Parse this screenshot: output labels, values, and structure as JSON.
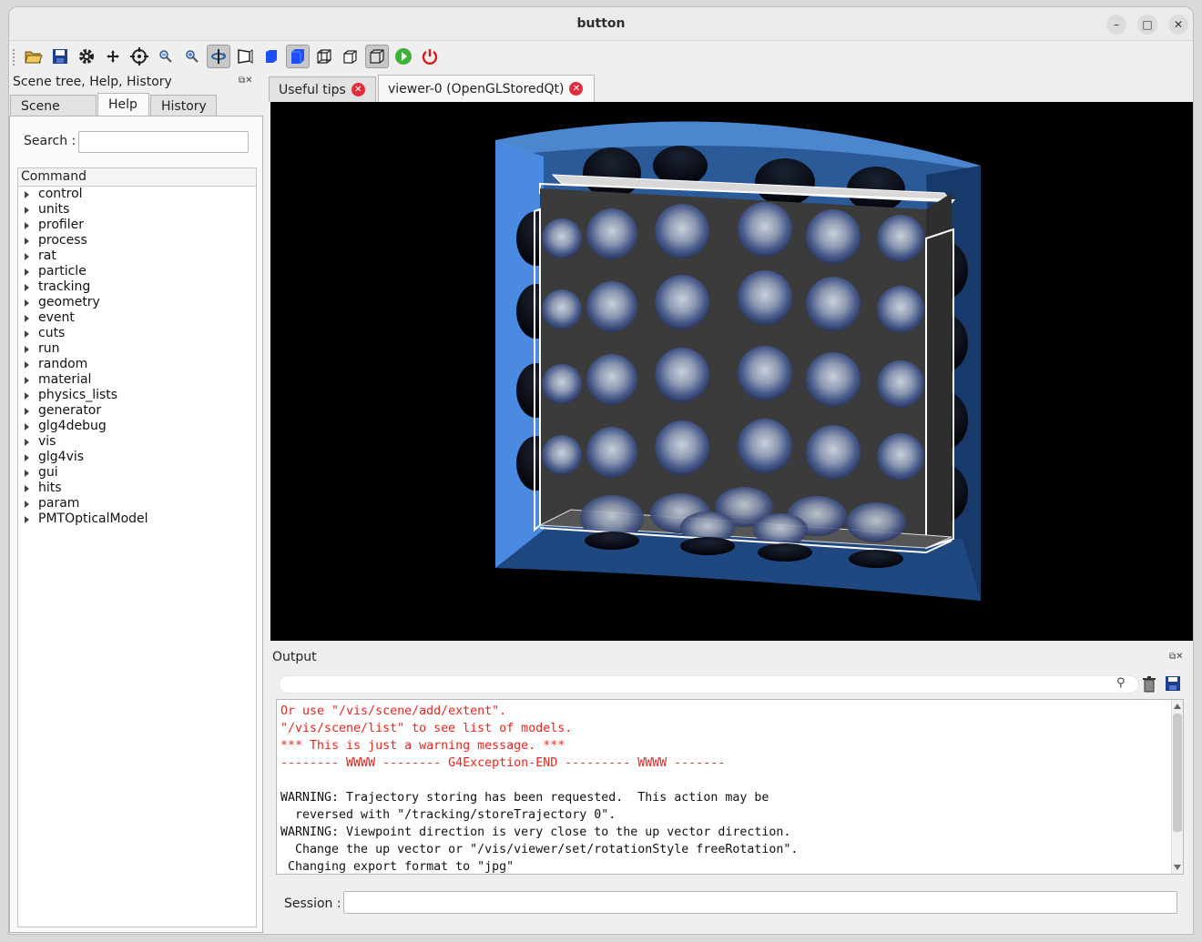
{
  "window": {
    "title": "button",
    "controls": {
      "minimize": "–",
      "maximize": "□",
      "close": "✕"
    }
  },
  "toolbar": {
    "items": [
      "open-icon",
      "save-icon",
      "gear-icon",
      "move-icon",
      "target-icon",
      "zoom-out-icon",
      "zoom-in-icon",
      "rotate-icon",
      "perspective-icon",
      "solid-blue-icon",
      "solid-shaded-icon",
      "wireframe-icon",
      "hidden-line-icon",
      "hidden-surface-icon",
      "run-icon",
      "power-icon"
    ]
  },
  "left_dock": {
    "title": "Scene tree, Help, History",
    "tabs": [
      {
        "label": "Scene tree"
      },
      {
        "label": "Help"
      },
      {
        "label": "History"
      }
    ],
    "active_tab": "Help",
    "search_label": "Search :",
    "search_value": "",
    "tree_header": "Command",
    "commands": [
      "control",
      "units",
      "profiler",
      "process",
      "rat",
      "particle",
      "tracking",
      "geometry",
      "event",
      "cuts",
      "run",
      "random",
      "material",
      "physics_lists",
      "generator",
      "glg4debug",
      "vis",
      "glg4vis",
      "gui",
      "hits",
      "param",
      "PMTOpticalModel"
    ]
  },
  "viewer_tabs": [
    {
      "label": "Useful tips"
    },
    {
      "label": "viewer-0 (OpenGLStoredQt)"
    }
  ],
  "output": {
    "label": "Output",
    "filter_value": "",
    "lines": [
      {
        "text": "Or use \"/vis/scene/add/extent\".",
        "color": "#e8261f"
      },
      {
        "text": "\"/vis/scene/list\" to see list of models.",
        "color": "#e8261f"
      },
      {
        "text": "*** This is just a warning message. ***",
        "color": "#e8261f"
      },
      {
        "text": "-------- WWWW -------- G4Exception-END --------- WWWW -------",
        "color": "#e8261f"
      },
      {
        "text": "",
        "color": "#111111"
      },
      {
        "text": "WARNING: Trajectory storing has been requested.  This action may be",
        "color": "#111111"
      },
      {
        "text": "  reversed with \"/tracking/storeTrajectory 0\".",
        "color": "#111111"
      },
      {
        "text": "WARNING: Viewpoint direction is very close to the up vector direction.",
        "color": "#111111"
      },
      {
        "text": "  Change the up vector or \"/vis/viewer/set/rotationStyle freeRotation\".",
        "color": "#111111"
      },
      {
        "text": " Changing export format to \"jpg\"",
        "color": "#111111"
      }
    ],
    "session_label": "Session :",
    "session_value": ""
  }
}
